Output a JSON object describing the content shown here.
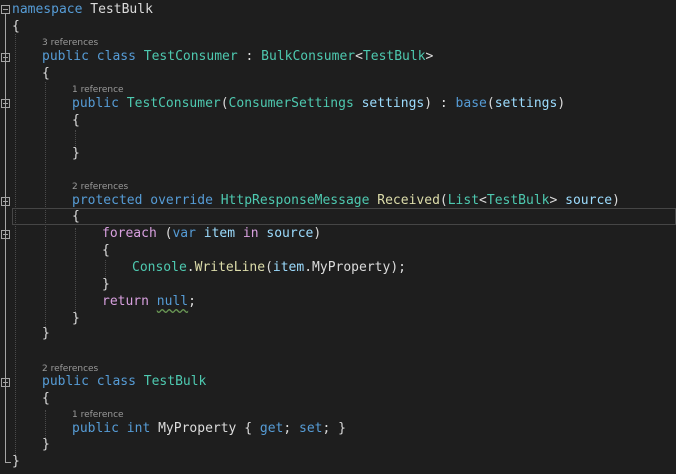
{
  "editor": {
    "lenses": {
      "consumer_refs": "3 references",
      "ctor_refs": "1 reference",
      "received_refs": "2 references",
      "bulk_refs": "2 references",
      "prop_refs": "1 reference"
    },
    "code": {
      "kw_namespace": "namespace",
      "ns_name": "TestBulk",
      "brace_open": "{",
      "brace_close": "}",
      "kw_public": "public",
      "kw_class": "class",
      "cls_test_consumer": "TestConsumer",
      "colon": ":",
      "cls_bulk_consumer": "BulkConsumer",
      "lt": "<",
      "gt": ">",
      "cls_test_bulk": "TestBulk",
      "ctor_name": "TestConsumer",
      "paren_open": "(",
      "paren_close": ")",
      "cls_consumer_settings": "ConsumerSettings",
      "param_settings": "settings",
      "kw_base": "base",
      "kw_protected": "protected",
      "kw_override": "override",
      "cls_http": "HttpResponseMessage",
      "mtd_received": "Received",
      "cls_list": "List",
      "param_source": "source",
      "kw_foreach": "foreach",
      "kw_var": "var",
      "var_item": "item",
      "kw_in": "in",
      "cls_console": "Console",
      "dot": ".",
      "mtd_writeline": "WriteLine",
      "prop_myproperty": "MyProperty",
      "semicolon": ";",
      "kw_return": "return",
      "kw_null": "null",
      "kw_int": "int",
      "prop_decl": "MyProperty",
      "kw_get": "get",
      "kw_set": "set"
    }
  }
}
